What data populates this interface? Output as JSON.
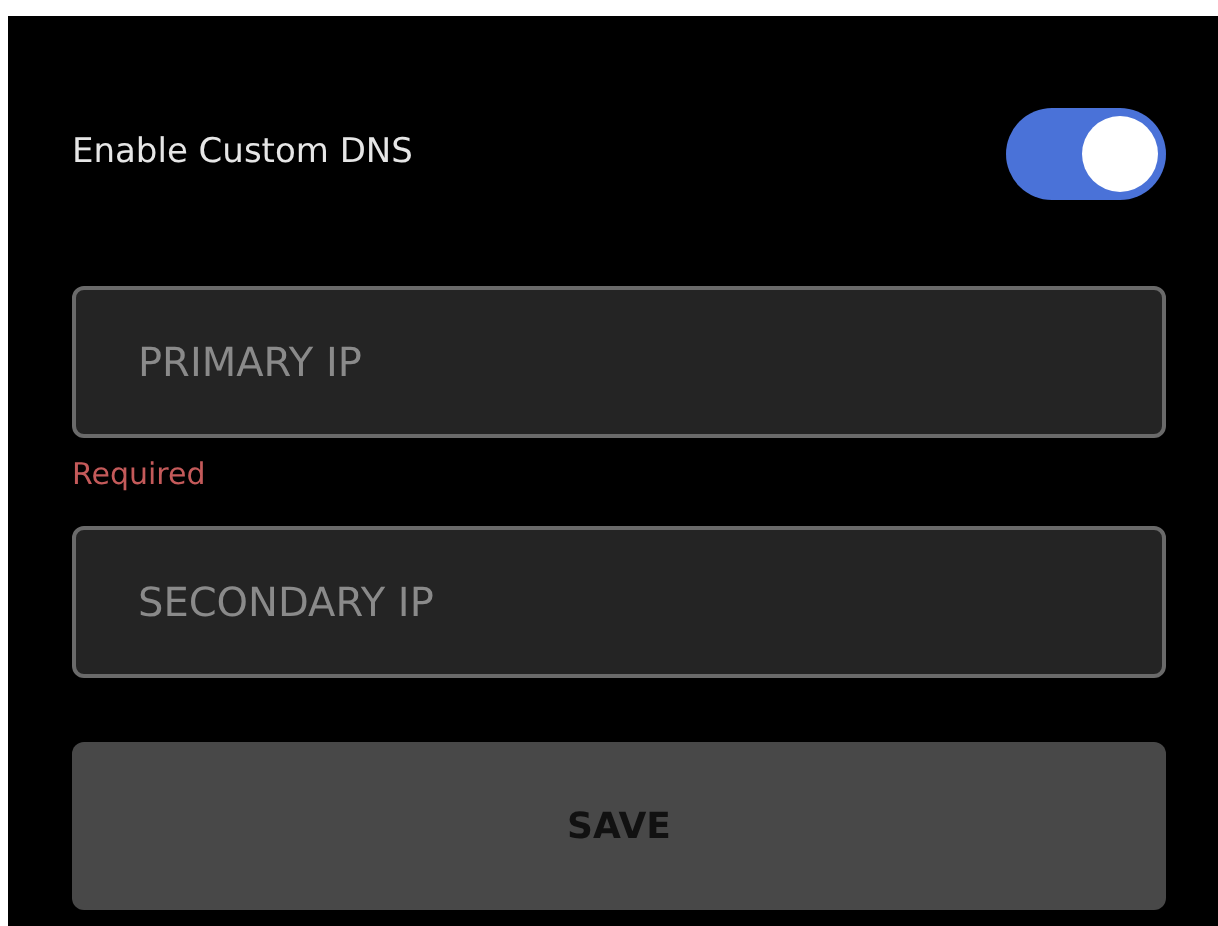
{
  "custom_dns": {
    "label": "Enable Custom DNS",
    "on": true
  },
  "primary_ip": {
    "placeholder": "PRIMARY IP",
    "error": "Required"
  },
  "secondary_ip": {
    "placeholder": "SECONDARY IP"
  },
  "save_button": {
    "label": "SAVE",
    "disabled": true
  }
}
